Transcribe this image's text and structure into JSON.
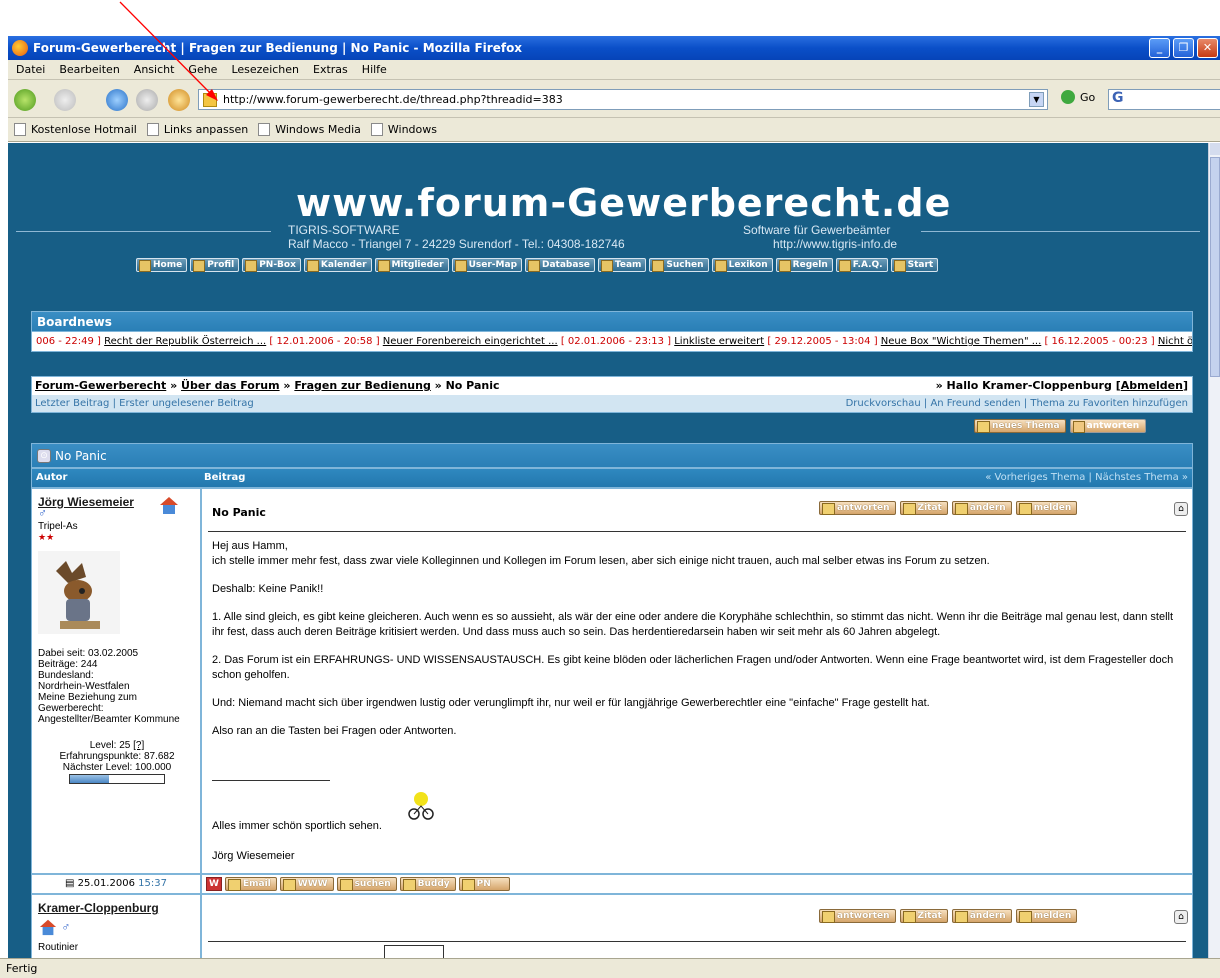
{
  "window": {
    "title": "Forum-Gewerberecht | Fragen zur Bedienung | No Panic - Mozilla Firefox"
  },
  "menu": [
    "Datei",
    "Bearbeiten",
    "Ansicht",
    "Gehe",
    "Lesezeichen",
    "Extras",
    "Hilfe"
  ],
  "toolbar": {
    "url": "http://www.forum-gewerberecht.de/thread.php?threadid=383",
    "go_label": "Go"
  },
  "bookmarks": [
    "Kostenlose Hotmail",
    "Links anpassen",
    "Windows Media",
    "Windows"
  ],
  "banner": {
    "logo": "www.forum-Gewerberecht.de",
    "company": "TIGRIS-SOFTWARE",
    "address": "Ralf Macco - Triangel 7 - 24229 Surendorf - Tel.: 04308-182746",
    "tagline": "Software für Gewerbeämter",
    "website": "http://www.tigris-info.de"
  },
  "mainnav": [
    "Home",
    "Profil",
    "PN-Box",
    "Kalender",
    "Mitglieder",
    "User-Map",
    "Database",
    "Team",
    "Suchen",
    "Lexikon",
    "Regeln",
    "F.A.Q.",
    "Start"
  ],
  "boardnews": {
    "title": "Boardnews",
    "items": [
      {
        "text": "",
        "date": "006 - 22:49 ]"
      },
      {
        "text": "Recht der Republik Österreich ...",
        "date": "[ 12.01.2006 - 20:58 ]"
      },
      {
        "text": "Neuer Forenbereich eingerichtet ...",
        "date": "[ 02.01.2006 - 23:13 ]"
      },
      {
        "text": "Linkliste erweitert",
        "date": "[ 29.12.2005 - 13:04 ]"
      },
      {
        "text": "Neue Box \"Wichtige Themen\" ...",
        "date": "[ 16.12.2005 - 00:23 ]"
      },
      {
        "text": "Nicht öffentliches Fo",
        "date": ""
      }
    ]
  },
  "breadcrumb": {
    "items": [
      "Forum-Gewerberecht",
      "Über das Forum",
      "Fragen zur Bedienung"
    ],
    "current": "No Panic",
    "greeting": "» Hallo Kramer-Cloppenburg",
    "logout": "Abmelden"
  },
  "subnav": {
    "left": [
      "Letzter Beitrag",
      "Erster ungelesener Beitrag"
    ],
    "right": [
      "Druckvorschau",
      "An Freund senden",
      "Thema zu Favoriten hinzufügen"
    ]
  },
  "thread_buttons": [
    "neues Thema",
    "antworten"
  ],
  "thread": {
    "title": "No Panic",
    "col_author": "Autor",
    "col_post": "Beitrag",
    "prev": "Vorheriges Thema",
    "next": "Nächstes Thema"
  },
  "post1": {
    "author": "Jörg Wiesemeier",
    "rank": "Tripel-As",
    "joined": "Dabei seit: 03.02.2005",
    "posts": "Beiträge: 244",
    "state_label": "Bundesland:",
    "state": "Nordrhein-Westfalen",
    "relation_label": "Meine Beziehung zum Gewerberecht:",
    "relation": "Angestellter/Beamter Kommune",
    "level": "Level: 25",
    "level_help": "[?]",
    "xp": "Erfahrungspunkte: 87.682",
    "next_level": "Nächster Level: 100.000",
    "level_progress": 0.42,
    "subject": "No Panic",
    "buttons": [
      "antworten",
      "Zitat",
      "ändern",
      "melden"
    ],
    "paragraphs": [
      "Hej aus Hamm,\nich stelle immer mehr fest, dass zwar viele Kolleginnen und Kollegen im Forum lesen, aber sich einige nicht trauen, auch mal selber etwas ins Forum zu setzen.",
      "Deshalb: Keine Panik!!",
      "1. Alle sind gleich, es gibt keine gleicheren. Auch wenn es so aussieht, als wär der eine oder andere die Koryphähe schlechthin, so stimmt das nicht. Wenn ihr die Beiträge mal genau lest, dann stellt ihr fest, dass auch deren Beiträge kritisiert werden. Und dass muss auch so sein. Das herdentieredarsein haben wir seit mehr als 60 Jahren abgelegt.",
      "2. Das Forum ist ein ERFAHRUNGS- UND WISSENSAUSTAUSCH. Es gibt keine blöden oder lächerlichen Fragen und/oder Antworten. Wenn eine Frage beantwortet wird, ist dem Fragesteller doch schon geholfen.",
      "Und: Niemand macht sich über irgendwen lustig oder verunglimpft ihr, nur weil er für langjährige Gewerberechtler eine \"einfache\" Frage gestellt hat.",
      "Also ran an die Tasten bei Fragen oder Antworten."
    ],
    "signature_line": "Alles immer schön sportlich sehen.",
    "signature_name": "Jörg Wiesemeier",
    "date": "25.01.2006",
    "time": "15:37",
    "footer_buttons": [
      "Email",
      "WWW",
      "suchen",
      "Buddy",
      "PN"
    ]
  },
  "post2": {
    "author": "Kramer-Cloppenburg",
    "rank": "Routinier",
    "buttons": [
      "antworten",
      "Zitat",
      "ändern",
      "melden"
    ]
  },
  "status": "Fertig",
  "colors": {
    "page_bg": "#175e86",
    "panel_head": "#2a7fb6",
    "titlebar": "#0a4fc8",
    "annotation_arrow": "#ff0000"
  }
}
